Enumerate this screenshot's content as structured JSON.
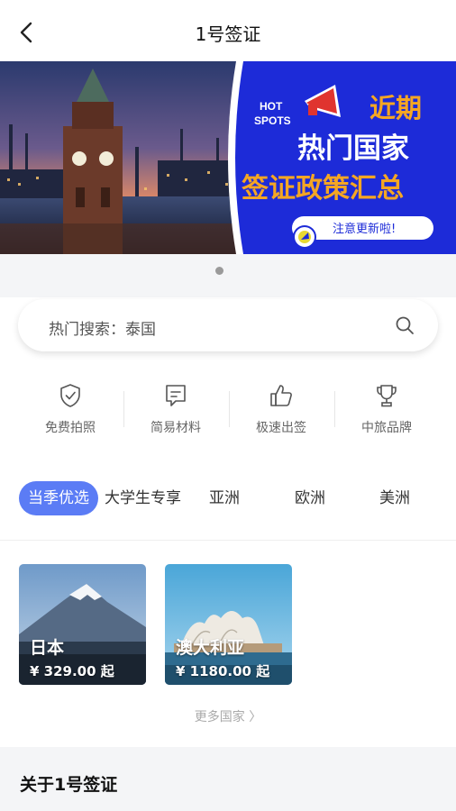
{
  "header": {
    "title": "1号签证",
    "back_icon": "chevron-left-icon"
  },
  "banner": {
    "badge_line1": "HOT",
    "badge_line2": "SPOTS",
    "headline1": "近期",
    "headline2": "热门国家",
    "headline3": "签证政策汇总",
    "pill": "注意更新啦!",
    "colors": {
      "blue": "#1d2bd8",
      "orange": "#f5a623",
      "white": "#ffffff"
    }
  },
  "carousel": {
    "count": 1,
    "active": 1
  },
  "search": {
    "label": "热门搜索：泰国",
    "icon": "search-icon"
  },
  "features": [
    {
      "label": "免费拍照",
      "icon": "shield-check-icon"
    },
    {
      "label": "简易材料",
      "icon": "document-message-icon"
    },
    {
      "label": "极速出签",
      "icon": "thumbs-up-icon"
    },
    {
      "label": "中旅品牌",
      "icon": "trophy-icon"
    }
  ],
  "tabs": [
    {
      "label": "当季优选",
      "active": true
    },
    {
      "label": "大学生专享"
    },
    {
      "label": "亚洲"
    },
    {
      "label": "欧洲"
    },
    {
      "label": "美洲"
    }
  ],
  "cards": [
    {
      "name": "日本",
      "price": "¥ 329.00 起"
    },
    {
      "name": "澳大利亚",
      "price": "¥ 1180.00 起"
    }
  ],
  "more": "更多国家 〉",
  "about": {
    "title": "关于1号签证"
  },
  "accent": "#5b7cf5"
}
